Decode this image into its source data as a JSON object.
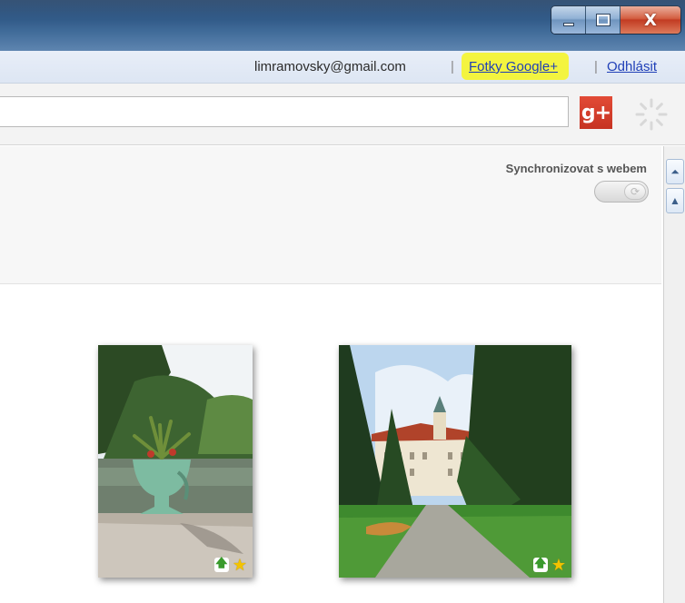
{
  "window": {
    "minimize_icon": "minimize-icon",
    "maximize_icon": "maximize-icon",
    "close_label": "X"
  },
  "account": {
    "email": "limramovsky@gmail.com",
    "separator": "|",
    "photos_link": "Fotky Google+",
    "logout_link": "Odhlásit",
    "highlight_color": "#f5f52b"
  },
  "search": {
    "value": "",
    "gplus_label": "g+",
    "spinner_icon": "loading-spinner-icon"
  },
  "settings": {
    "sync_label": "Synchronizovat s webem",
    "sync_toggle_icon": "sync-icon"
  },
  "photos": [
    {
      "name": "urn-by-pond",
      "uploaded": true,
      "starred": true
    },
    {
      "name": "castle-avenue",
      "uploaded": true,
      "starred": true
    }
  ],
  "badges": {
    "upload_symbol": "🡅",
    "star_symbol": "★"
  },
  "colors": {
    "accent_link": "#1f3fb7",
    "gplus_red": "#d23f2a"
  }
}
